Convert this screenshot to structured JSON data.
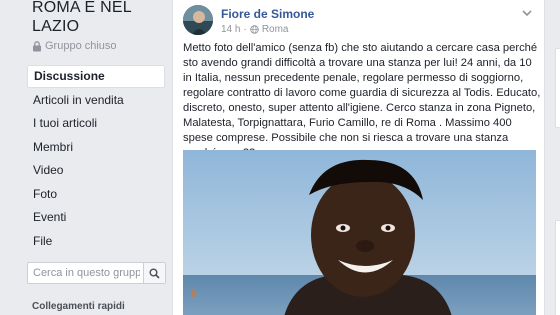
{
  "group": {
    "title": "ROMA E NEL LAZIO",
    "type_label": "Gruppo chiuso"
  },
  "nav": {
    "items": [
      {
        "label": "Discussione",
        "active": true
      },
      {
        "label": "Articoli in vendita",
        "active": false
      },
      {
        "label": "I tuoi articoli",
        "active": false
      },
      {
        "label": "Membri",
        "active": false
      },
      {
        "label": "Video",
        "active": false
      },
      {
        "label": "Foto",
        "active": false
      },
      {
        "label": "Eventi",
        "active": false
      },
      {
        "label": "File",
        "active": false
      }
    ]
  },
  "search": {
    "placeholder": "Cerca in questo gruppo"
  },
  "quick_links_label": "Collegamenti rapidi",
  "post": {
    "author": "Fiore de Simone",
    "time": "14 h",
    "location": "Roma",
    "text": "Metto foto dell'amico (senza fb) che sto aiutando a cercare casa perché sto avendo grandi difficoltà a trovare una stanza per lui! 24 anni, da 10 in Italia, nessun precedente penale, regolare permesso di soggiorno, regolare contratto di lavoro come guardia di sicurezza al Todis. Educato, discreto, onesto, super attento all'igiene. Cerco stanza in zona Pigneto, Malatesta, Torpignattara, Furio Camillo, re di Roma . Massimo 400 spese comprese. Possibile che non si riesca a trovare una stanza perché nero??"
  },
  "colors": {
    "page_bg": "#e9ebee",
    "link_blue": "#365899",
    "text": "#1d2129",
    "muted": "#90949c"
  }
}
